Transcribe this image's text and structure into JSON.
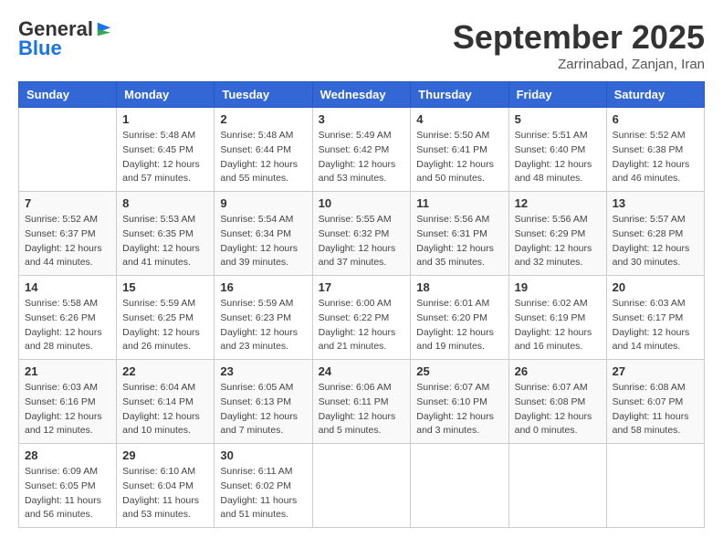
{
  "header": {
    "logo_line1": "General",
    "logo_line2": "Blue",
    "month": "September 2025",
    "location": "Zarrinabad, Zanjan, Iran"
  },
  "weekdays": [
    "Sunday",
    "Monday",
    "Tuesday",
    "Wednesday",
    "Thursday",
    "Friday",
    "Saturday"
  ],
  "weeks": [
    [
      {
        "num": "",
        "info": ""
      },
      {
        "num": "1",
        "info": "Sunrise: 5:48 AM\nSunset: 6:45 PM\nDaylight: 12 hours\nand 57 minutes."
      },
      {
        "num": "2",
        "info": "Sunrise: 5:48 AM\nSunset: 6:44 PM\nDaylight: 12 hours\nand 55 minutes."
      },
      {
        "num": "3",
        "info": "Sunrise: 5:49 AM\nSunset: 6:42 PM\nDaylight: 12 hours\nand 53 minutes."
      },
      {
        "num": "4",
        "info": "Sunrise: 5:50 AM\nSunset: 6:41 PM\nDaylight: 12 hours\nand 50 minutes."
      },
      {
        "num": "5",
        "info": "Sunrise: 5:51 AM\nSunset: 6:40 PM\nDaylight: 12 hours\nand 48 minutes."
      },
      {
        "num": "6",
        "info": "Sunrise: 5:52 AM\nSunset: 6:38 PM\nDaylight: 12 hours\nand 46 minutes."
      }
    ],
    [
      {
        "num": "7",
        "info": "Sunrise: 5:52 AM\nSunset: 6:37 PM\nDaylight: 12 hours\nand 44 minutes."
      },
      {
        "num": "8",
        "info": "Sunrise: 5:53 AM\nSunset: 6:35 PM\nDaylight: 12 hours\nand 41 minutes."
      },
      {
        "num": "9",
        "info": "Sunrise: 5:54 AM\nSunset: 6:34 PM\nDaylight: 12 hours\nand 39 minutes."
      },
      {
        "num": "10",
        "info": "Sunrise: 5:55 AM\nSunset: 6:32 PM\nDaylight: 12 hours\nand 37 minutes."
      },
      {
        "num": "11",
        "info": "Sunrise: 5:56 AM\nSunset: 6:31 PM\nDaylight: 12 hours\nand 35 minutes."
      },
      {
        "num": "12",
        "info": "Sunrise: 5:56 AM\nSunset: 6:29 PM\nDaylight: 12 hours\nand 32 minutes."
      },
      {
        "num": "13",
        "info": "Sunrise: 5:57 AM\nSunset: 6:28 PM\nDaylight: 12 hours\nand 30 minutes."
      }
    ],
    [
      {
        "num": "14",
        "info": "Sunrise: 5:58 AM\nSunset: 6:26 PM\nDaylight: 12 hours\nand 28 minutes."
      },
      {
        "num": "15",
        "info": "Sunrise: 5:59 AM\nSunset: 6:25 PM\nDaylight: 12 hours\nand 26 minutes."
      },
      {
        "num": "16",
        "info": "Sunrise: 5:59 AM\nSunset: 6:23 PM\nDaylight: 12 hours\nand 23 minutes."
      },
      {
        "num": "17",
        "info": "Sunrise: 6:00 AM\nSunset: 6:22 PM\nDaylight: 12 hours\nand 21 minutes."
      },
      {
        "num": "18",
        "info": "Sunrise: 6:01 AM\nSunset: 6:20 PM\nDaylight: 12 hours\nand 19 minutes."
      },
      {
        "num": "19",
        "info": "Sunrise: 6:02 AM\nSunset: 6:19 PM\nDaylight: 12 hours\nand 16 minutes."
      },
      {
        "num": "20",
        "info": "Sunrise: 6:03 AM\nSunset: 6:17 PM\nDaylight: 12 hours\nand 14 minutes."
      }
    ],
    [
      {
        "num": "21",
        "info": "Sunrise: 6:03 AM\nSunset: 6:16 PM\nDaylight: 12 hours\nand 12 minutes."
      },
      {
        "num": "22",
        "info": "Sunrise: 6:04 AM\nSunset: 6:14 PM\nDaylight: 12 hours\nand 10 minutes."
      },
      {
        "num": "23",
        "info": "Sunrise: 6:05 AM\nSunset: 6:13 PM\nDaylight: 12 hours\nand 7 minutes."
      },
      {
        "num": "24",
        "info": "Sunrise: 6:06 AM\nSunset: 6:11 PM\nDaylight: 12 hours\nand 5 minutes."
      },
      {
        "num": "25",
        "info": "Sunrise: 6:07 AM\nSunset: 6:10 PM\nDaylight: 12 hours\nand 3 minutes."
      },
      {
        "num": "26",
        "info": "Sunrise: 6:07 AM\nSunset: 6:08 PM\nDaylight: 12 hours\nand 0 minutes."
      },
      {
        "num": "27",
        "info": "Sunrise: 6:08 AM\nSunset: 6:07 PM\nDaylight: 11 hours\nand 58 minutes."
      }
    ],
    [
      {
        "num": "28",
        "info": "Sunrise: 6:09 AM\nSunset: 6:05 PM\nDaylight: 11 hours\nand 56 minutes."
      },
      {
        "num": "29",
        "info": "Sunrise: 6:10 AM\nSunset: 6:04 PM\nDaylight: 11 hours\nand 53 minutes."
      },
      {
        "num": "30",
        "info": "Sunrise: 6:11 AM\nSunset: 6:02 PM\nDaylight: 11 hours\nand 51 minutes."
      },
      {
        "num": "",
        "info": ""
      },
      {
        "num": "",
        "info": ""
      },
      {
        "num": "",
        "info": ""
      },
      {
        "num": "",
        "info": ""
      }
    ]
  ]
}
